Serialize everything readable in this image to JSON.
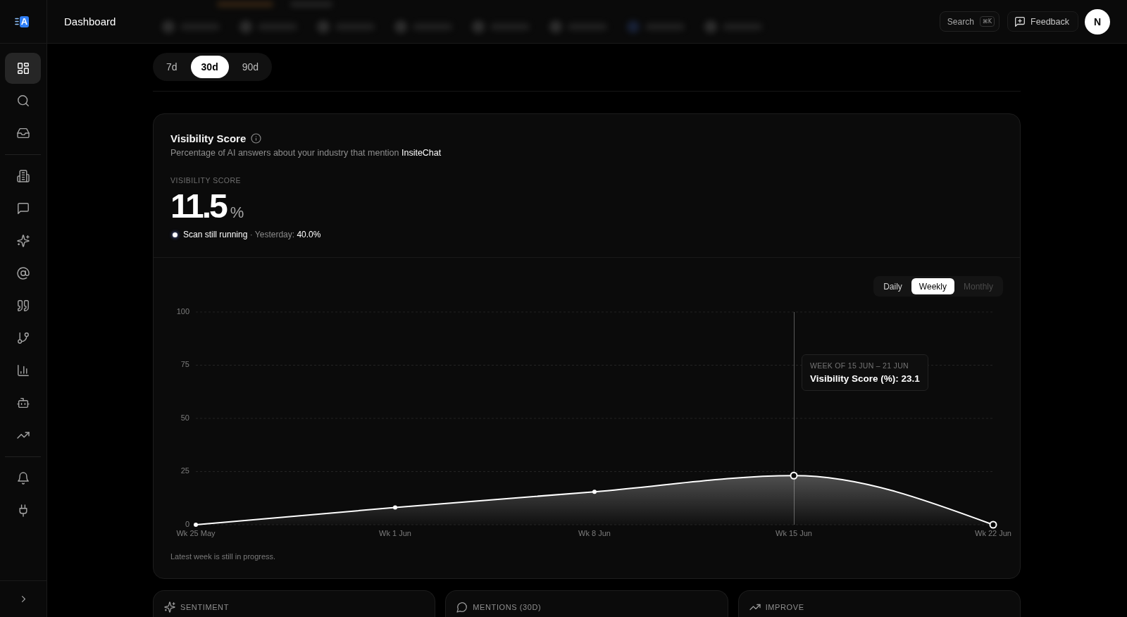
{
  "sidebar": {
    "logo": "A",
    "sections": [
      {
        "items": [
          {
            "selected": true
          },
          {
            "selected": false
          },
          {
            "selected": false
          }
        ]
      },
      {
        "items": [
          {
            "selected": false
          },
          {
            "selected": false
          },
          {
            "selected": false
          },
          {
            "selected": false
          },
          {
            "selected": false
          },
          {
            "selected": false
          },
          {
            "selected": false
          },
          {
            "selected": false
          },
          {
            "selected": false
          }
        ]
      },
      {
        "items": [
          {
            "selected": false
          },
          {
            "selected": false
          }
        ]
      }
    ]
  },
  "header": {
    "title": "Dashboard",
    "search": {
      "label": "Search",
      "shortcut": "⌘K"
    },
    "feedback": "Feedback",
    "avatar": "N"
  },
  "periods": [
    {
      "label": "7d",
      "selected": false
    },
    {
      "label": "30d",
      "selected": true
    },
    {
      "label": "90d",
      "selected": false
    }
  ],
  "visibility_card": {
    "title": "Visibility Score",
    "subtitle": "Percentage of AI answers about your industry that mention **InsiteChat**",
    "metric_label": "VISIBILITY SCORE",
    "value": "11.5",
    "unit": "%",
    "status": "**Scan still running** · Yesterday: **40.0%**",
    "granularity": [
      {
        "label": "Daily",
        "selected": false,
        "disabled": false
      },
      {
        "label": "Weekly",
        "selected": true,
        "disabled": false
      },
      {
        "label": "Monthly",
        "selected": false,
        "disabled": true
      }
    ],
    "chart": {
      "points": [
        {
          "hovered": false,
          "partial": false
        },
        {
          "hovered": false,
          "partial": false
        },
        {
          "hovered": false,
          "partial": false
        },
        {
          "hovered": true,
          "partial": false
        },
        {
          "hovered": false,
          "partial": true
        }
      ],
      "tooltip": {
        "header": "WEEK OF 15 JUN – 21 JUN",
        "text": "Visibility Score (%): 23.1"
      },
      "chart_data": {
        "type": "area",
        "categories": [
          "Wk 25 May",
          "Wk 1 Jun",
          "Wk 8 Jun",
          "Wk 15 Jun",
          "Wk 22 Jun"
        ],
        "series": [
          {
            "color": "#ffffff",
            "values": [
              0,
              8.1,
              15.5,
              23.1,
              0
            ]
          }
        ],
        "ylim": [
          0,
          100
        ],
        "yticks": [
          0,
          25,
          50,
          75,
          100
        ],
        "grid": true
      }
    },
    "note": "Latest week is still in progress."
  },
  "summary_cards": [
    {
      "title": "SENTIMENT"
    },
    {
      "title": "MENTIONS (30D)"
    },
    {
      "title": "IMPROVE"
    }
  ]
}
